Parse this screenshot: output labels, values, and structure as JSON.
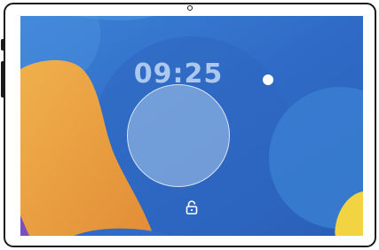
{
  "lockscreen": {
    "time": "09:25"
  },
  "icons": {
    "lock": "lock-icon",
    "camera": "front-camera-icon",
    "status_dot": "notification-dot-icon"
  },
  "colors": {
    "wallpaper_blue": "#2f6fc8",
    "orange_shape": "#e9a441",
    "yellow_shape": "#f2d443",
    "ring_fill": "#aac8eb"
  }
}
